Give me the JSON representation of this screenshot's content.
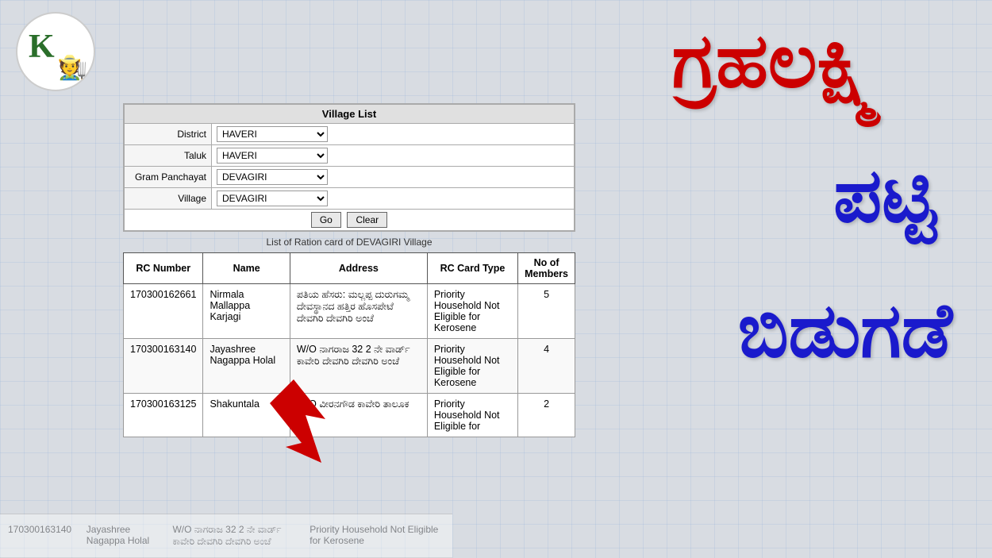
{
  "logo": {
    "letter": "K",
    "aria": "K logo with figure"
  },
  "form": {
    "title": "Village List",
    "district_label": "District",
    "district_value": "HAVERI",
    "taluk_label": "Taluk",
    "taluk_value": "HAVERI",
    "gram_panchayat_label": "Gram Panchayat",
    "gram_panchayat_value": "DEVAGIRI",
    "village_label": "Village",
    "village_value": "DEVAGIRI",
    "go_button": "Go",
    "clear_button": "Clear"
  },
  "table_caption": "List of Ration card of DEVAGIRI Village",
  "table_headers": {
    "rc_number": "RC Number",
    "name": "Name",
    "address": "Address",
    "rc_card_type": "RC Card Type",
    "no_of_members": "No of Members"
  },
  "rows": [
    {
      "rc_number": "170300162661",
      "name": "Nirmala Mallappa Karjagi",
      "address": "ಪತಿಯ ಹೆಸರು: ಮಲ್ಲಪ್ಪ ದುರುಗಮ್ಮ ದೇವಸ್ಥಾನದ ಹತ್ತಿರ ಹೊಸಪೇಟೆ ದೇವಗಿರಿ ದೇವಗಿರಿ ಅಂಚೆ",
      "rc_card_type": "Priority Household Not Eligible for Kerosene",
      "members": "5"
    },
    {
      "rc_number": "170300163140",
      "name": "Jayashree Nagappa Holal",
      "address": "W/O ನಾಗರಾಜ 32 2 ನೇ ವಾರ್ಡ್ ಕಾವೇರಿ ದೇವಗಿರಿ ದೇವಗಿರಿ ಅಂಚೆ",
      "rc_card_type": "Priority Household Not Eligible for Kerosene",
      "members": "4"
    },
    {
      "rc_number": "170300163125",
      "name": "Shakuntala",
      "address": "W/O ವೀರನಗೌಡ ಕಾವೇರಿ ತಾಲೂಕ",
      "rc_card_type": "Priority Household Not Eligible for",
      "members": "2"
    }
  ],
  "kannada_texts": {
    "line1": "ಗ್ರಹಲಕ್ಷ್ಮಿ",
    "line2": "ಪಟ್ಟಿ",
    "line3": "ಬಿಡುಗಡೆ"
  },
  "faded_rows": [
    {
      "rc": "170300163140",
      "name": "Jayashree Nagappa Holal",
      "address": "W/O ನಾಗರಾಜ 32 2 ನೇ ವಾರ್ಡ್ ಕಾವೇರಿ ದೇವಗಿರಿ ದೇವಗಿರಿ ಅಂಚೆ",
      "rctype": "Priority Household Not Eligible for Kerosene"
    }
  ]
}
